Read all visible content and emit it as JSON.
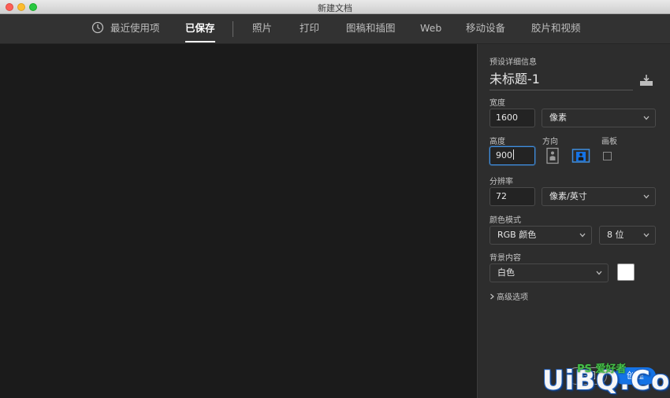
{
  "window": {
    "title": "新建文档"
  },
  "tabs": [
    {
      "label": "最近使用项",
      "icon": "clock-icon"
    },
    {
      "label": "已保存",
      "active": true
    },
    {
      "label": "照片"
    },
    {
      "label": "打印"
    },
    {
      "label": "图稿和插图"
    },
    {
      "label": "Web"
    },
    {
      "label": "移动设备"
    },
    {
      "label": "胶片和视频"
    }
  ],
  "details": {
    "section_title": "预设详细信息",
    "doc_name": "未标题-1",
    "width_label": "宽度",
    "width_value": "1600",
    "width_unit": "像素",
    "height_label": "高度",
    "height_value": "900",
    "orientation_label": "方向",
    "artboard_label": "画板",
    "resolution_label": "分辨率",
    "resolution_value": "72",
    "resolution_unit": "像素/英寸",
    "color_mode_label": "颜色模式",
    "color_mode": "RGB 颜色",
    "bit_depth": "8 位",
    "background_label": "背景内容",
    "background": "白色",
    "background_swatch": "#ffffff",
    "advanced_label": "高级选项"
  },
  "buttons": {
    "close": "关闭",
    "create": "创建"
  },
  "watermark": {
    "text": "UiBQ.CoM",
    "badge": "PS 爱好者"
  },
  "colors": {
    "accent": "#1473e6",
    "focus": "#3f8ee0",
    "panel": "#2d2d2d",
    "background": "#1b1b1b"
  }
}
